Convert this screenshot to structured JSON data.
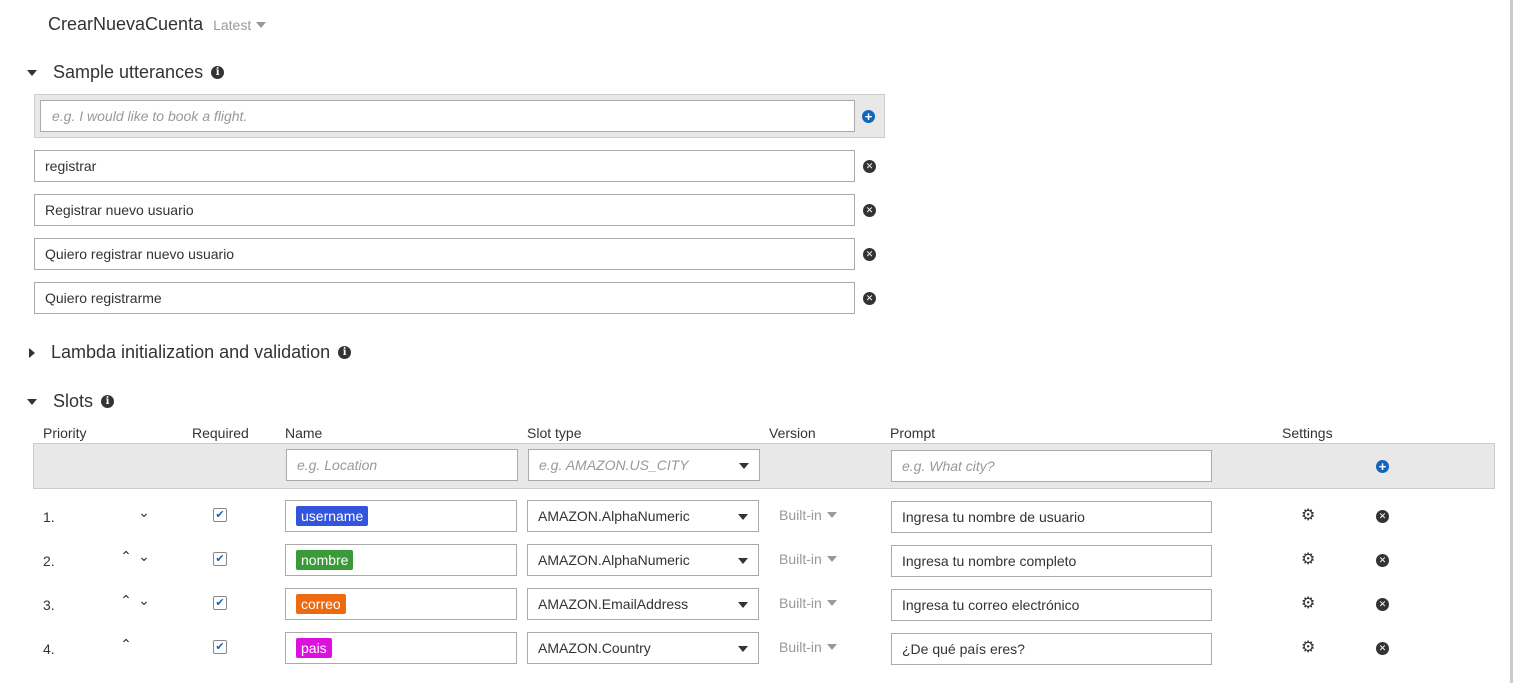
{
  "intent": {
    "name": "CrearNuevaCuenta",
    "version": "Latest"
  },
  "sample_utterances": {
    "title": "Sample utterances",
    "placeholder": "e.g. I would like to book a flight.",
    "items": [
      "registrar",
      "Registrar nuevo usuario",
      "Quiero registrar nuevo usuario",
      "Quiero registrarme"
    ]
  },
  "lambda": {
    "title": "Lambda initialization and validation"
  },
  "slots": {
    "title": "Slots",
    "columns": {
      "priority": "Priority",
      "required": "Required",
      "name": "Name",
      "slot_type": "Slot type",
      "version": "Version",
      "prompt": "Prompt",
      "settings": "Settings"
    },
    "new_row": {
      "name_placeholder": "e.g. Location",
      "type_placeholder": "e.g. AMAZON.US_CITY",
      "prompt_placeholder": "e.g. What city?"
    },
    "rows": [
      {
        "priority": "1.",
        "up": false,
        "down": true,
        "required": true,
        "name": "username",
        "color": "#3355dd",
        "type": "AMAZON.AlphaNumeric",
        "version": "Built-in",
        "prompt": "Ingresa tu nombre de usuario"
      },
      {
        "priority": "2.",
        "up": true,
        "down": true,
        "required": true,
        "name": "nombre",
        "color": "#3a9a3a",
        "type": "AMAZON.AlphaNumeric",
        "version": "Built-in",
        "prompt": "Ingresa tu nombre completo"
      },
      {
        "priority": "3.",
        "up": true,
        "down": true,
        "required": true,
        "name": "correo",
        "color": "#ee6a10",
        "type": "AMAZON.EmailAddress",
        "version": "Built-in",
        "prompt": "Ingresa tu correo electrónico"
      },
      {
        "priority": "4.",
        "up": true,
        "down": false,
        "required": true,
        "name": "pais",
        "color": "#dd11dd",
        "type": "AMAZON.Country",
        "version": "Built-in",
        "prompt": "¿De qué país eres?"
      }
    ]
  }
}
